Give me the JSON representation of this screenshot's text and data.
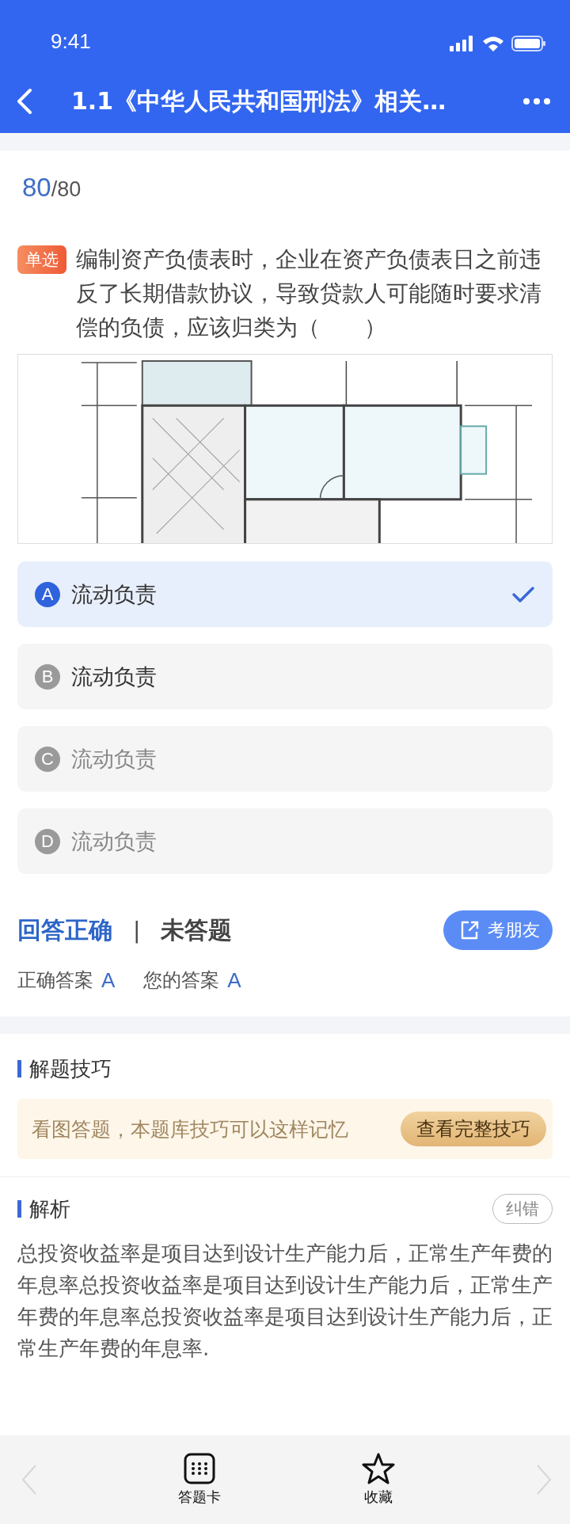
{
  "status_bar": {
    "time": "9:41"
  },
  "header": {
    "title": "1.1《中华人民共和国刑法》相关…"
  },
  "progress": {
    "current": "80",
    "total": "/80"
  },
  "question": {
    "tag": "单选",
    "text": "编制资产负债表时，企业在资产负债表日之前违反了长期借款协议，导致贷款人可能随时要求清偿的负债，应该归类为（　　）"
  },
  "options": [
    {
      "letter": "A",
      "text": "流动负责",
      "selected": true,
      "dimmed": false
    },
    {
      "letter": "B",
      "text": "流动负责",
      "selected": false,
      "dimmed": false
    },
    {
      "letter": "C",
      "text": "流动负责",
      "selected": false,
      "dimmed": true
    },
    {
      "letter": "D",
      "text": "流动负责",
      "selected": false,
      "dimmed": true
    }
  ],
  "result": {
    "verdict": "回答正确",
    "separator": "|",
    "state": "未答题",
    "share_button": "考朋友",
    "correct_label": "正确答案",
    "correct_value": "A",
    "yours_label": "您的答案",
    "yours_value": "A"
  },
  "tips": {
    "title": "解题技巧",
    "text": "看图答题，本题库技巧可以这样记忆",
    "button": "查看完整技巧"
  },
  "analysis": {
    "title": "解析",
    "report_button": "纠错",
    "text": "总投资收益率是项目达到设计生产能力后，正常生产年费的年息率总投资收益率是项目达到设计生产能力后，正常生产年费的年息率总投资收益率是项目达到设计生产能力后，正常生产年费的年息率."
  },
  "bottom_bar": [
    {
      "kind": "card",
      "label": "答题卡"
    },
    {
      "kind": "star",
      "label": "收藏"
    }
  ]
}
